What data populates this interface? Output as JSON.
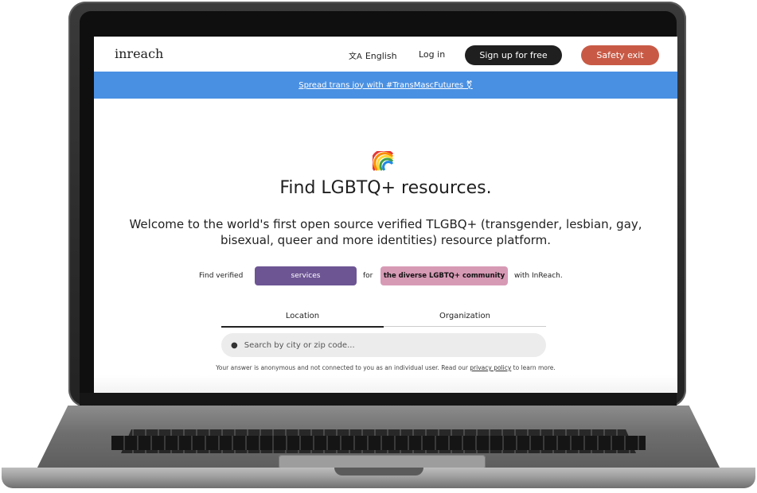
{
  "nav": {
    "logo": "inreach",
    "language_label": "English",
    "login_label": "Log in",
    "signup_label": "Sign up for free",
    "safety_exit_label": "Safety exit",
    "colors": {
      "signup_bg": "#1f1f1f",
      "safety_bg": "#c85a45"
    }
  },
  "banner": {
    "text": "Spread trans joy with #TransMascFutures ⚧",
    "color": "#4a90e2"
  },
  "hero": {
    "emoji": "rainbow",
    "headline": "Find LGBTQ+ resources.",
    "welcome_line1": "Welcome to the world's first open source verified TLGBQ+ (transgender, lesbian, gay,",
    "welcome_line2": "bisexual, queer and more identities) resource platform."
  },
  "finder": {
    "prefix": "Find verified",
    "service_selector": "services",
    "connector": "for",
    "community_selector": "the diverse LGBTQ+ community",
    "suffix": "with InReach.",
    "colors": {
      "service_bg": "#6d5594",
      "community_bg": "#d79ab5"
    }
  },
  "tabs": [
    {
      "label": "Location",
      "active": true
    },
    {
      "label": "Organization",
      "active": false
    }
  ],
  "search": {
    "placeholder": "Search by city or zip code..."
  },
  "privacy_note": {
    "before": "Your answer is anonymous and not connected to you as an individual user. Read our ",
    "link": "privacy policy",
    "after": " to learn more."
  }
}
